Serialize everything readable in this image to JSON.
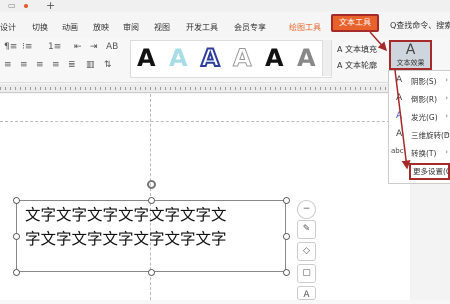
{
  "titlebar": {
    "plus": "+"
  },
  "menu": {
    "items": [
      "设计",
      "切换",
      "动画",
      "放映",
      "审阅",
      "视图",
      "开发工具",
      "会员专享",
      "绘图工具"
    ],
    "active_tab": "文本工具",
    "search": "Q查找命令、搜索"
  },
  "ribbon": {
    "style_glyph": "A",
    "fill_label": "A 文本填充",
    "outline_label": "A 文本轮廓",
    "effect_label": "文本效果",
    "effect_glyph": "A"
  },
  "textbox": {
    "line1": "文字文字文字文字文字文字文",
    "line2": "字文字文字文字文字文字文字"
  },
  "dropdown": {
    "items": [
      {
        "icon": "A",
        "label": "阴影(S)"
      },
      {
        "icon": "A",
        "label": "倒影(R)"
      },
      {
        "icon": "A",
        "label": "发光(G)"
      },
      {
        "icon": "A",
        "label": "三维旋转(D)"
      },
      {
        "icon": "abc",
        "label": "转换(T)"
      }
    ],
    "more": "更多设置(O)"
  },
  "side_tools": [
    "−",
    "✎",
    "◇",
    "▢",
    "A"
  ],
  "colors": {
    "accent": "#e8632b",
    "highlight_border": "#a52a2a"
  }
}
